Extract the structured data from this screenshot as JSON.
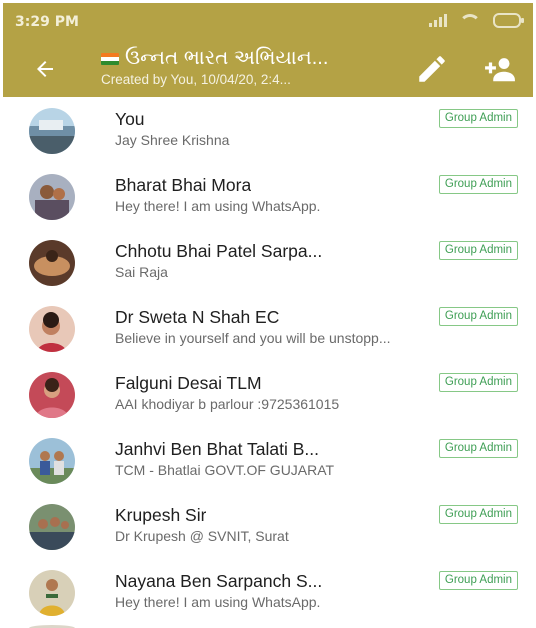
{
  "status_bar": {
    "time": "3:29 PM"
  },
  "header": {
    "title": "ઉન્નત ભારત અભિયાન...",
    "subtitle": "Created by You, 10/04/20, 2:4...",
    "back_icon": "arrow-left-icon",
    "edit_icon": "pencil-icon",
    "add_icon": "add-person-icon",
    "color": "#b4a245"
  },
  "participants": [
    {
      "name": "You",
      "status": "Jay Shree Krishna",
      "badge": "Group Admin"
    },
    {
      "name": "Bharat Bhai Mora",
      "status": "Hey there! I am using WhatsApp.",
      "badge": "Group Admin"
    },
    {
      "name": "Chhotu Bhai Patel Sarpa...",
      "status": "Sai Raja",
      "badge": "Group Admin"
    },
    {
      "name": "Dr Sweta N Shah EC",
      "status": "Believe in yourself and you will be unstopp...",
      "badge": "Group Admin"
    },
    {
      "name": "Falguni Desai TLM",
      "status": "AAI khodiyar b parlour :9725361015",
      "badge": "Group Admin"
    },
    {
      "name": "Janhvi Ben Bhat Talati B...",
      "status": "TCM - Bhatlai GOVT.OF GUJARAT",
      "badge": "Group Admin"
    },
    {
      "name": "Krupesh Sir",
      "status": "Dr Krupesh @ SVNIT, Surat",
      "badge": "Group Admin"
    },
    {
      "name": "Nayana Ben Sarpanch S...",
      "status": "Hey there! I am using WhatsApp.",
      "badge": "Group Admin"
    }
  ],
  "badge_color": "#3e9e54"
}
